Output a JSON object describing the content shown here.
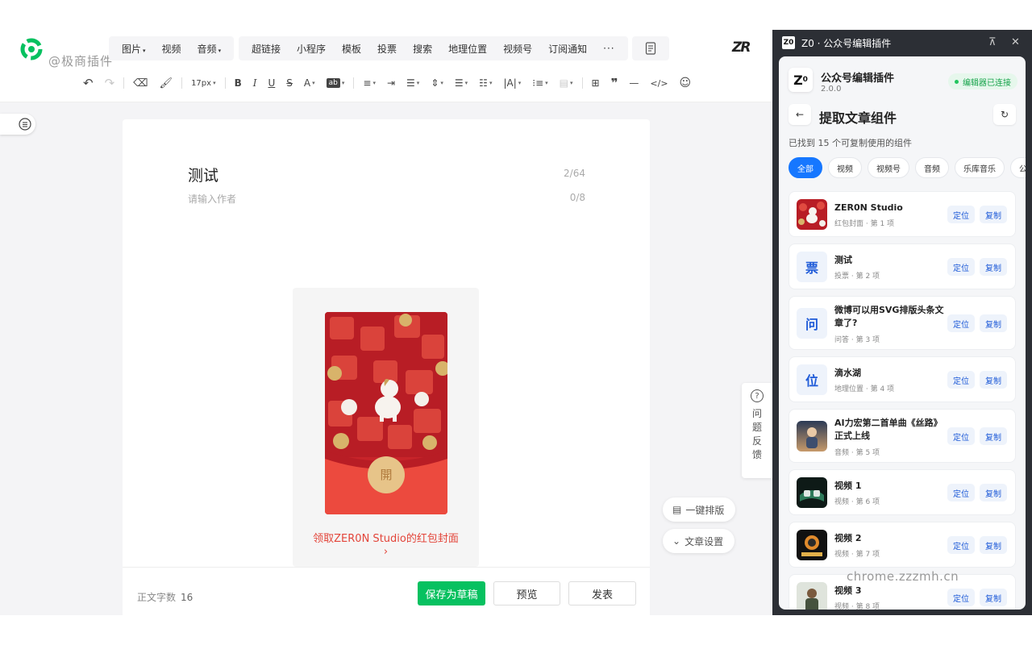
{
  "editor": {
    "watermark": "@极商插件",
    "menu_media": [
      {
        "label": "图片",
        "caret": "▾"
      },
      {
        "label": "视频",
        "caret": ""
      },
      {
        "label": "音频",
        "caret": "▾"
      }
    ],
    "menu_insert": [
      "超链接",
      "小程序",
      "模板",
      "投票",
      "搜索",
      "地理位置",
      "视频号",
      "订阅通知"
    ],
    "more": "···",
    "brand_mark": "ZR",
    "font_size": "17px",
    "title": "测试",
    "title_count": "2/64",
    "author_placeholder": "请输入作者",
    "author_count": "0/8",
    "redpacket_text": "领取ZER0N Studio的红包封面",
    "redpacket_arrow": "›",
    "open_char": "開",
    "word_count_label": "正文字数",
    "word_count": "16",
    "save_label": "保存为草稿",
    "preview_label": "预览",
    "publish_label": "发表",
    "feedback_label": [
      "问",
      "题",
      "反",
      "馈"
    ],
    "one_click_layout": "一键排版",
    "article_settings": "文章设置"
  },
  "plugin": {
    "window_title": "Z0 · 公众号编辑插件",
    "badge": "Z0",
    "name": "公众号编辑插件",
    "version": "2.0.0",
    "status": "编辑器已连接",
    "page_title": "提取文章组件",
    "found_text": "已找到 15 个可复制使用的组件",
    "filters": [
      "全部",
      "视频",
      "视频号",
      "音频",
      "乐库音乐",
      "公众"
    ],
    "locate_label": "定位",
    "copy_label": "复制",
    "items": [
      {
        "name": "ZER0N Studio",
        "sub": "红包封面 · 第 1 项",
        "thumb": "redpacket"
      },
      {
        "name": "测试",
        "sub": "投票 · 第 2 项",
        "thumb": "票"
      },
      {
        "name": "微博可以用SVG排版头条文章了?",
        "sub": "问答 · 第 3 项",
        "thumb": "问"
      },
      {
        "name": "滴水湖",
        "sub": "地理位置 · 第 4 项",
        "thumb": "位"
      },
      {
        "name": "AI力宏第二首单曲《丝路》正式上线",
        "sub": "音频 · 第 5 项",
        "thumb": "audio"
      },
      {
        "name": "视频 1",
        "sub": "视频 · 第 6 项",
        "thumb": "video1"
      },
      {
        "name": "视频 2",
        "sub": "视频 · 第 7 项",
        "thumb": "video2"
      },
      {
        "name": "视频 3",
        "sub": "视频 · 第 8 项",
        "thumb": "video3"
      }
    ]
  },
  "site_watermark": "chrome.zzzmh.cn",
  "colors": {
    "primary_green": "#07c160",
    "accent_blue": "#1677ff",
    "redpacket_red": "#c8242a",
    "status_green": "#16a34a"
  }
}
